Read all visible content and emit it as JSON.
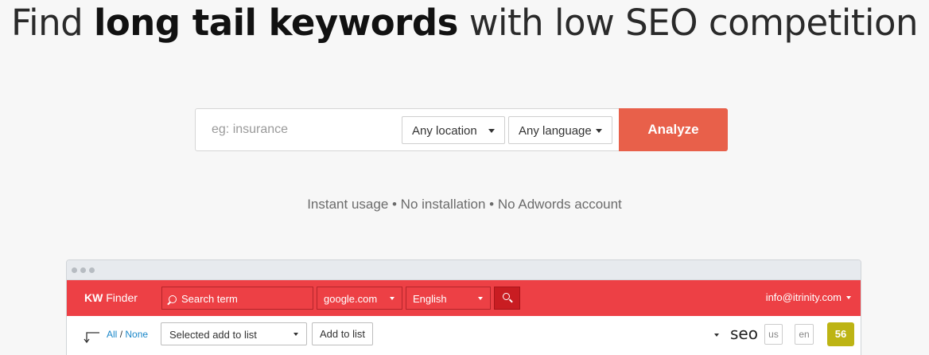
{
  "hero": {
    "headline_prefix": "Find",
    "headline_bold": "long tail keywords",
    "headline_suffix": "with low SEO competition"
  },
  "search": {
    "placeholder": "eg: insurance",
    "location": "Any location",
    "language": "Any language",
    "analyze_label": "Analyze"
  },
  "tagline": "Instant usage • No installation • No Adwords account",
  "app": {
    "logo_bold": "KW",
    "logo_text": "Finder",
    "search_placeholder": "Search term",
    "engine": "google.com",
    "language": "English",
    "user": "info@itrinity.com",
    "toolbar": {
      "all_label": "All",
      "separator": "/",
      "none_label": "None",
      "list_select": "Selected add to list",
      "add_to_list": "Add to list",
      "keyword": "seo",
      "country_pill": "us",
      "lang_pill": "en",
      "score": "56",
      "score_color": "#bdb414"
    }
  },
  "colors": {
    "accent": "#e8604a",
    "app_red": "#ed4045",
    "link_blue": "#1a87c9"
  }
}
